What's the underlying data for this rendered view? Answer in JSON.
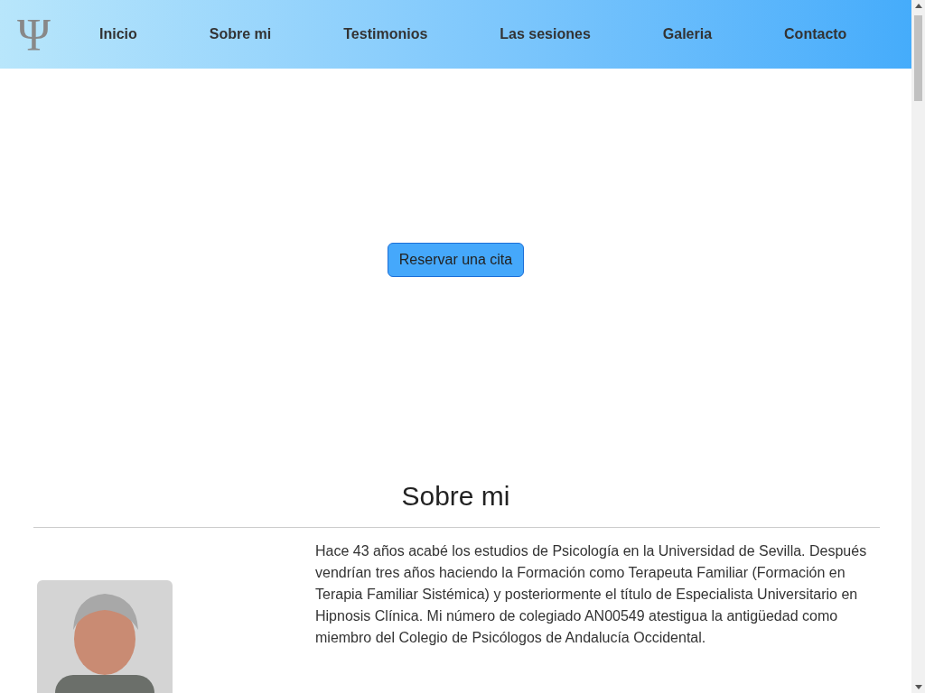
{
  "header": {
    "logo": "Ψ",
    "nav": [
      {
        "label": "Inicio"
      },
      {
        "label": "Sobre mi"
      },
      {
        "label": "Testimonios"
      },
      {
        "label": "Las sesiones"
      },
      {
        "label": "Galeria"
      },
      {
        "label": "Contacto"
      }
    ]
  },
  "hero": {
    "button": "Reservar una cita"
  },
  "about": {
    "heading": "Sobre mi",
    "text": "Hace 43 años acabé los estudios de Psicología en la Universidad de Sevilla. Después vendrían tres años haciendo la Formación como Terapeuta Familiar (Formación en Terapia Familiar Sistémica) y posteriormente el título de Especialista Universitario en Hipnosis Clínica. Mi número de colegiado AN00549 atestigua la antigüedad como miembro del Colegio de Psicólogos de Andalucía Occidental."
  }
}
